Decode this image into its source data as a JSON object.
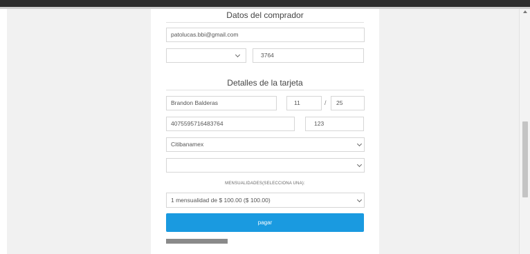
{
  "buyer": {
    "title": "Datos del comprador",
    "email": "patolucas.bbi@gmail.com",
    "doc_type": "",
    "doc_number": "3764"
  },
  "card": {
    "title": "Detalles de la tarjeta",
    "holder": "Brandon Balderas",
    "exp_month": "11",
    "exp_separator": "/",
    "exp_year": "25",
    "number": "4075595716483764",
    "cvv": "123",
    "issuer": "Citibanamex",
    "secondary_select": ""
  },
  "installments": {
    "label": "MENSUALIDADES(SELECCIONA UNA):",
    "selected": "1 mensualidad de $ 100.00 ($ 100.00)"
  },
  "actions": {
    "pay_label": "pagar"
  },
  "colors": {
    "pay_button": "#1a9ae0",
    "top_bar": "#2d2d2d"
  }
}
